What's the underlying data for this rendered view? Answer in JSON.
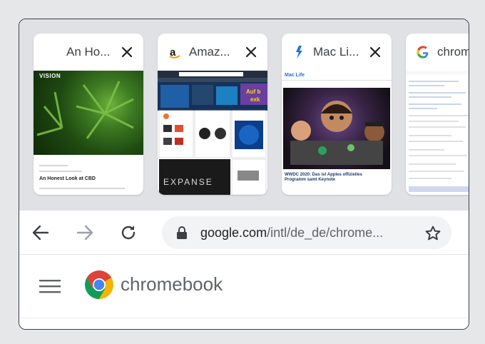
{
  "tabs": [
    {
      "title": "An Ho...",
      "thumb": {
        "logo": "VISION",
        "headline": "An Honest Look at CBD"
      }
    },
    {
      "title": "Amaz...",
      "thumb": {
        "banner": "Auf b\nexk",
        "footer": "EXPANSE"
      }
    },
    {
      "title": "Mac Li...",
      "thumb": {
        "logo": "Mac Life",
        "headline": "WWDC 2020: Das ist Apples offizielles Programm samt Keynote"
      }
    },
    {
      "title": "chrom"
    }
  ],
  "toolbar": {
    "url_domain": "google.com",
    "url_path": "/intl/de_de/chrome..."
  },
  "page": {
    "brand": "chromebook"
  },
  "icons": {
    "back": "back-arrow-icon",
    "forward": "forward-arrow-icon",
    "reload": "reload-icon",
    "lock": "lock-icon",
    "star": "bookmark-star-icon",
    "menu": "hamburger-menu-icon",
    "close": "close-icon"
  },
  "colors": {
    "chrome_red": "#db4437",
    "chrome_green": "#0f9d58",
    "chrome_yellow": "#f4b400",
    "chrome_blue": "#4285f4",
    "macrumor_blue": "#1e73d8"
  }
}
